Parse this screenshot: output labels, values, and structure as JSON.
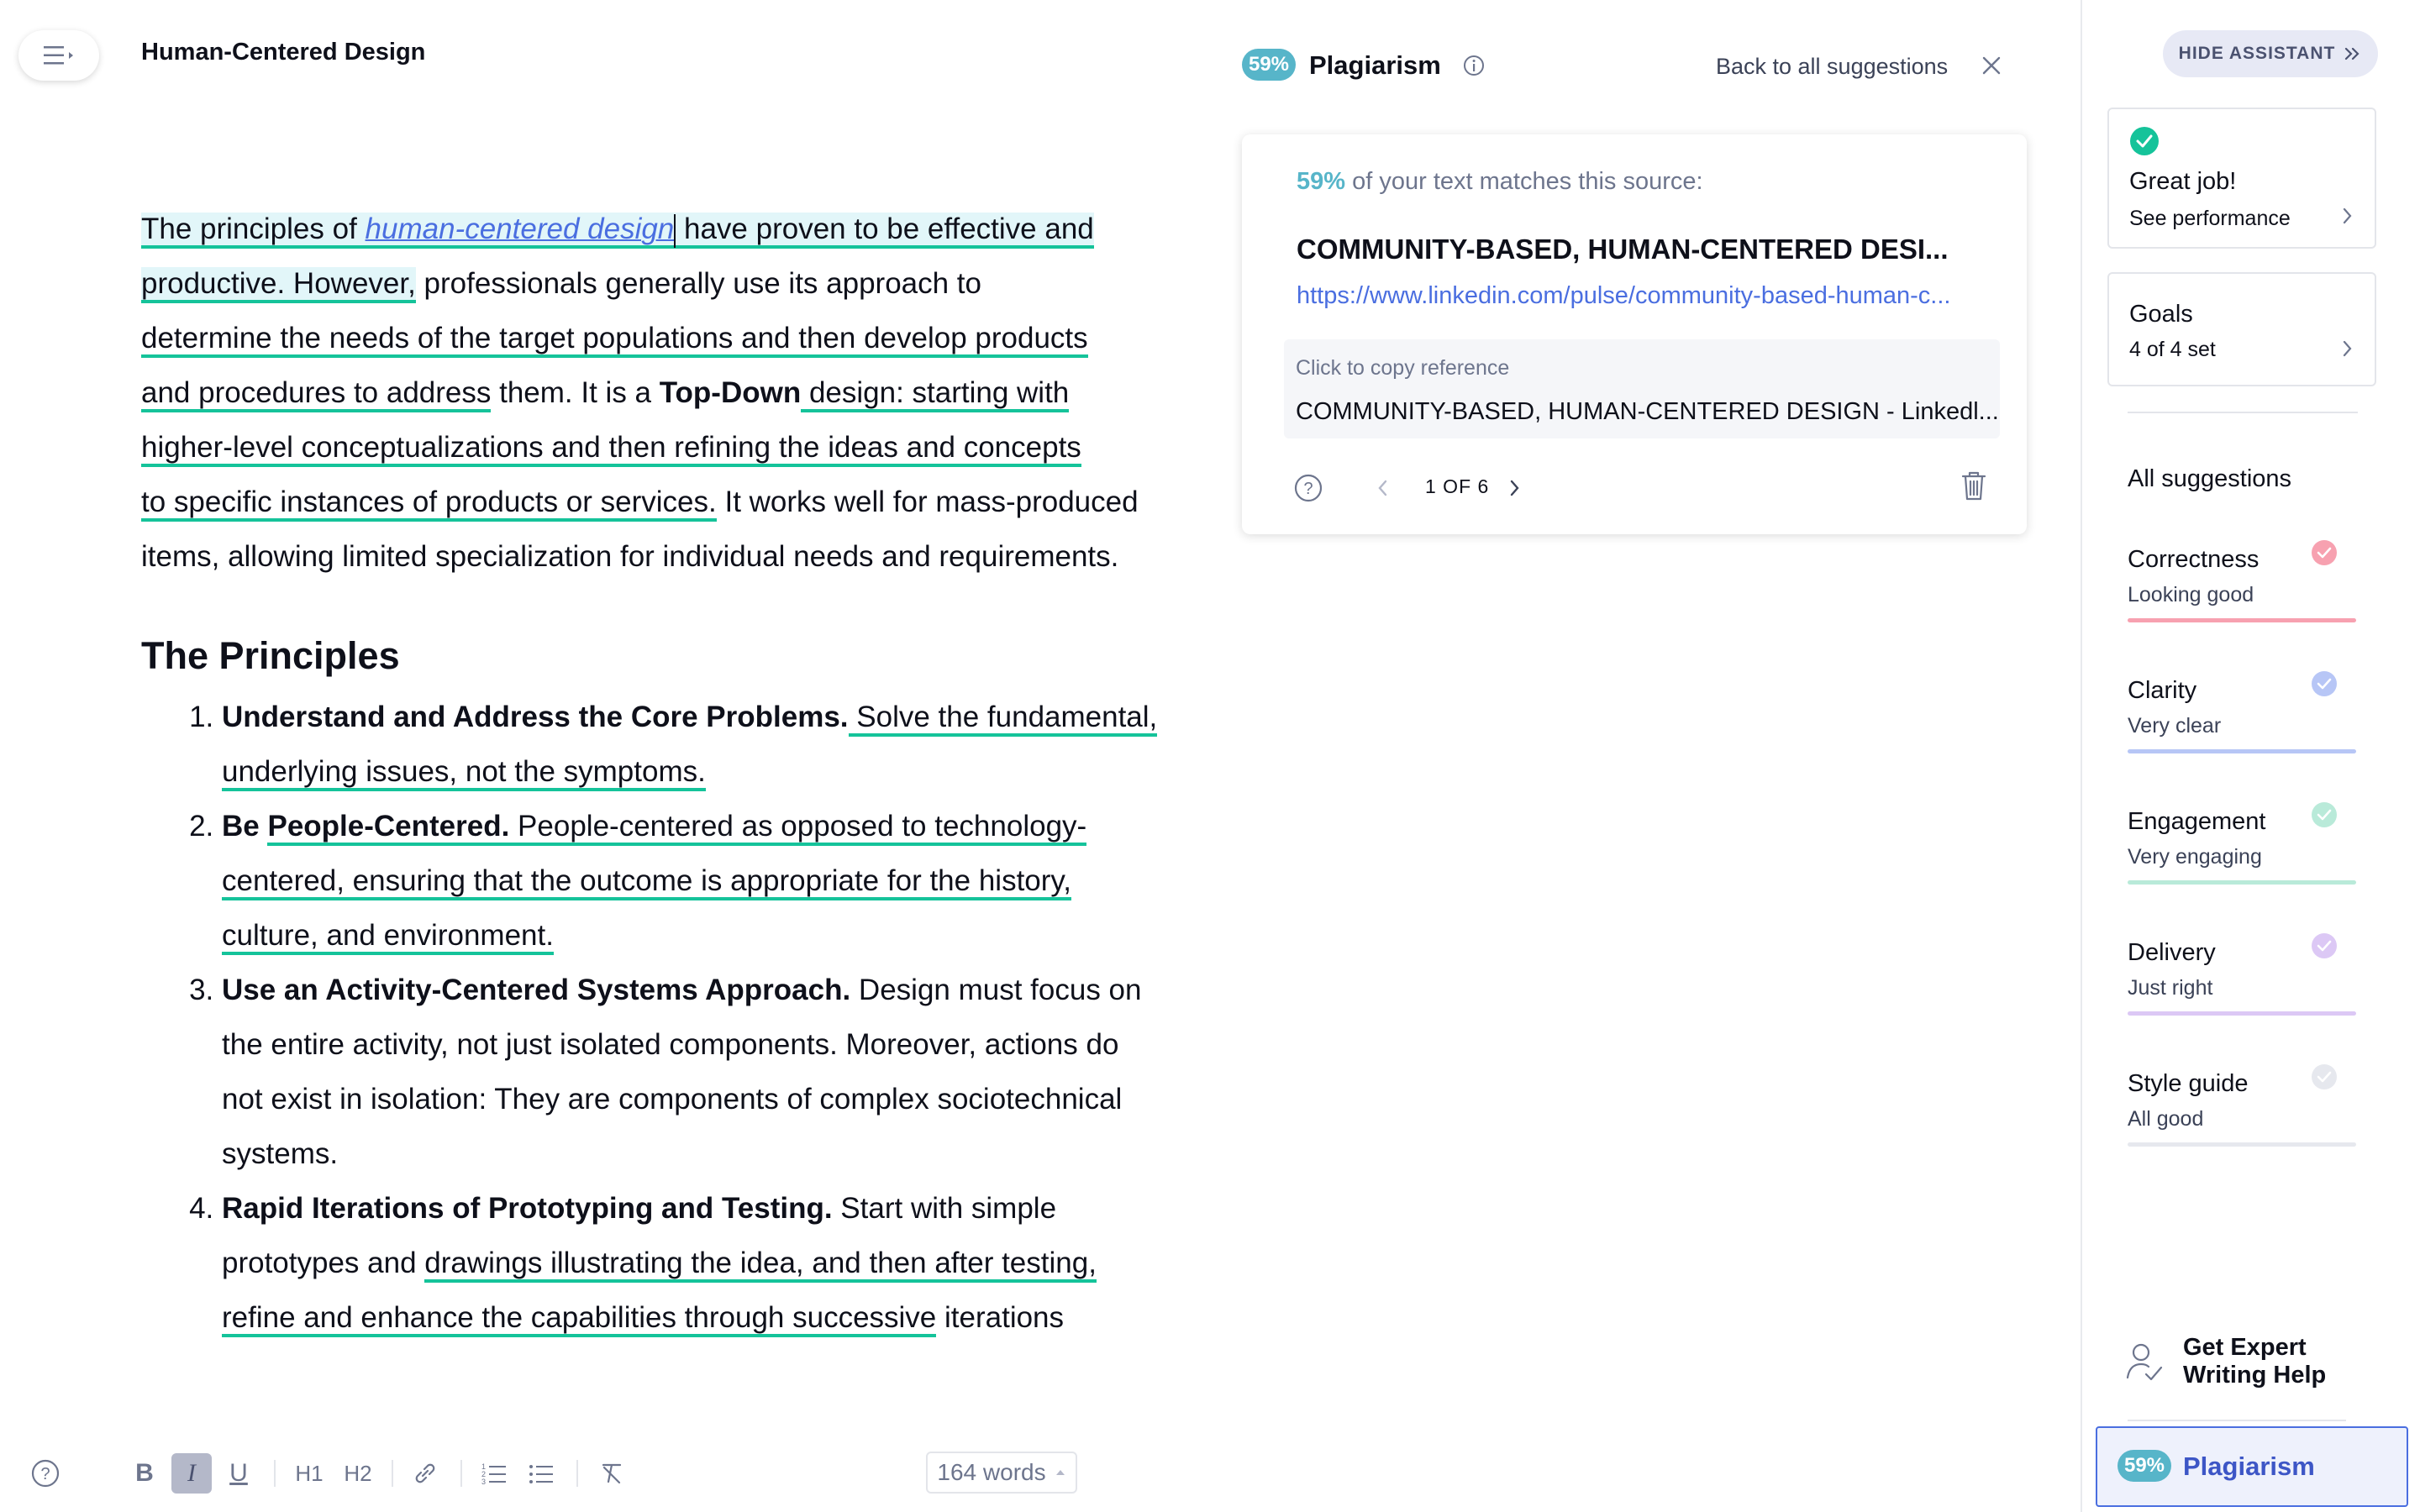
{
  "document": {
    "title": "Human-Centered Design",
    "intro": {
      "t1": "The principles of ",
      "link": "human-centered design",
      "t2": " have proven to be effective and",
      "t3": "productive. However,",
      "t4": " professionals generally use its approach to",
      "u1": "determine the needs of the target populations and then develop products",
      "u2": "and procedures to address",
      "t5": " them. It is a ",
      "bold1": "Top-Down",
      "u3": " design: starting with",
      "u4": "higher-level conceptualizations and then refining the ideas and concepts",
      "u5": "to specific instances of products or services.",
      "t6": " It works well for mass-produced items, allowing limited specialization for individual needs and requirements."
    },
    "heading": "The Principles",
    "items": [
      {
        "bold": "Understand and Address the Core Problems.",
        "u": " Solve the fundamental, underlying issues, not the symptoms.",
        "rest": ""
      },
      {
        "bold_a": "Be ",
        "bold_b": "People-Centered.",
        "u": " People-centered as opposed to technology-centered, ensuring that the outcome is appropriate for the history, culture, and environment.",
        "rest": ""
      },
      {
        "bold": "Use an Activity-Centered Systems Approach.",
        "rest": " Design must focus on the entire activity, not just isolated components. Moreover, actions do not exist in isolation: They are components of complex sociotechnical systems."
      },
      {
        "bold": "Rapid Iterations of Prototyping and Testing.",
        "rest": " Start with simple prototypes and ",
        "u": "drawings illustrating the idea, and then after testing, refine and enhance the capabilities through successive",
        "rest2": " iterations"
      }
    ]
  },
  "toolbar": {
    "word_count": "164 words",
    "h1": "H1",
    "h2": "H2"
  },
  "plagiarism": {
    "percent": "59%",
    "title": "Plagiarism",
    "back_link": "Back to all suggestions",
    "match_percent": "59%",
    "match_text": " of your text matches this source:",
    "source_title": "COMMUNITY-BASED, HUMAN-CENTERED DESI...",
    "source_url": "https://www.linkedin.com/pulse/community-based-human-c...",
    "copy_label": "Click to copy reference",
    "copy_reference": "COMMUNITY-BASED, HUMAN-CENTERED DESIGN - Linkedl...",
    "pager": "1 OF 6"
  },
  "sidebar": {
    "hide_button": "HIDE ASSISTANT",
    "great_job_title": "Great job!",
    "great_job_sub": "See performance",
    "goals_title": "Goals",
    "goals_sub": "4 of 4 set",
    "all_suggestions": "All suggestions",
    "categories": [
      {
        "name": "Correctness",
        "status": "Looking good",
        "color": "#f7a1b0"
      },
      {
        "name": "Clarity",
        "status": "Very clear",
        "color": "#b7c6f6"
      },
      {
        "name": "Engagement",
        "status": "Very engaging",
        "color": "#b9ead9"
      },
      {
        "name": "Delivery",
        "status": "Just right",
        "color": "#dcc8f5"
      },
      {
        "name": "Style guide",
        "status": "All good",
        "color": "#e6e8ee"
      }
    ],
    "expert_help_line1": "Get Expert",
    "expert_help_line2": "Writing Help",
    "plagiarism_percent": "59%",
    "plagiarism_label": "Plagiarism"
  },
  "colors": {
    "accent_teal": "#57b5c9",
    "underline_green": "#15c39a",
    "link_blue": "#4a6ee0",
    "success_green": "#15c39a"
  }
}
